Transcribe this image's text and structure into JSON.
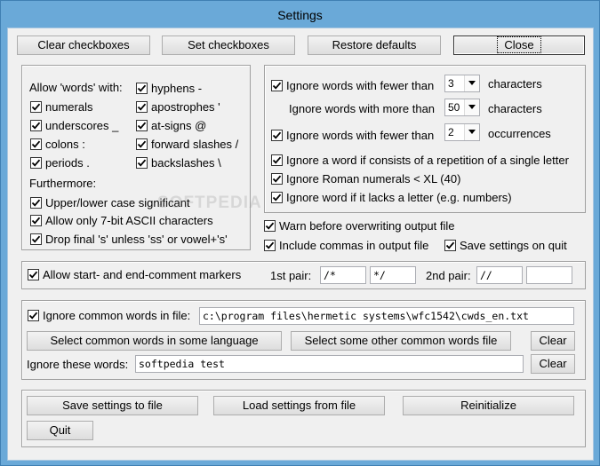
{
  "window": {
    "title": "Settings"
  },
  "top_buttons": {
    "clear": "Clear checkboxes",
    "set": "Set checkboxes",
    "restore": "Restore defaults",
    "close": "Close"
  },
  "words_group": {
    "allow_label": "Allow 'words' with:",
    "items": {
      "hyphens": {
        "label": "hyphens -",
        "checked": true
      },
      "numerals": {
        "label": "numerals",
        "checked": true
      },
      "apostrophes": {
        "label": "apostrophes '",
        "checked": true
      },
      "underscores": {
        "label": "underscores _",
        "checked": true
      },
      "at_signs": {
        "label": "at-signs @",
        "checked": true
      },
      "colons": {
        "label": "colons :",
        "checked": true
      },
      "forward_slashes": {
        "label": "forward slashes /",
        "checked": true
      },
      "periods": {
        "label": "periods .",
        "checked": true
      },
      "backslashes": {
        "label": "backslashes \\",
        "checked": true
      }
    },
    "furthermore_label": "Furthermore:",
    "extra": {
      "case": {
        "label": "Upper/lower case significant",
        "checked": true
      },
      "ascii": {
        "label": "Allow only 7-bit ASCII characters",
        "checked": true
      },
      "drop_s": {
        "label": "Drop final 's' unless 'ss' or vowel+'s'",
        "checked": true
      }
    }
  },
  "ignore_group": {
    "fewer_chars": {
      "label": "Ignore words with fewer than",
      "checked": true,
      "value": "3",
      "suffix": "characters"
    },
    "more_chars": {
      "label": "Ignore words with more than",
      "value": "50",
      "suffix": "characters"
    },
    "fewer_occ": {
      "label": "Ignore words with fewer than",
      "checked": true,
      "value": "2",
      "suffix": "occurrences"
    },
    "repetition": {
      "label": "Ignore a word if consists of a repetition of a single letter",
      "checked": true
    },
    "roman": {
      "label": "Ignore Roman numerals < XL (40)",
      "checked": true
    },
    "lacks_letter": {
      "label": "Ignore word if it lacks a letter (e.g. numbers)",
      "checked": true
    }
  },
  "output_options": {
    "warn": {
      "label": "Warn before overwriting output file",
      "checked": true
    },
    "commas": {
      "label": "Include commas in output file",
      "checked": true
    },
    "save_quit": {
      "label": "Save settings on quit",
      "checked": true
    }
  },
  "comments": {
    "allow": {
      "label": "Allow start- and end-comment markers",
      "checked": true
    },
    "first_pair_label": "1st pair:",
    "first_start": "/*",
    "first_end": "*/",
    "second_pair_label": "2nd pair:",
    "second_start": "//",
    "second_end": ""
  },
  "common_words": {
    "ignore": {
      "label": "Ignore common words in file:",
      "checked": true
    },
    "file_path": "c:\\program files\\hermetic systems\\wfc1542\\cwds_en.txt",
    "select_language": "Select common words in some language",
    "select_other": "Select some other common words file",
    "clear1": "Clear",
    "ignore_these_label": "Ignore these words:",
    "ignore_these_value": "softpedia test",
    "clear2": "Clear"
  },
  "bottom_buttons": {
    "save": "Save settings to file",
    "load": "Load settings from file",
    "reinit": "Reinitialize",
    "quit": "Quit"
  },
  "watermark": "SOFTPEDIA"
}
